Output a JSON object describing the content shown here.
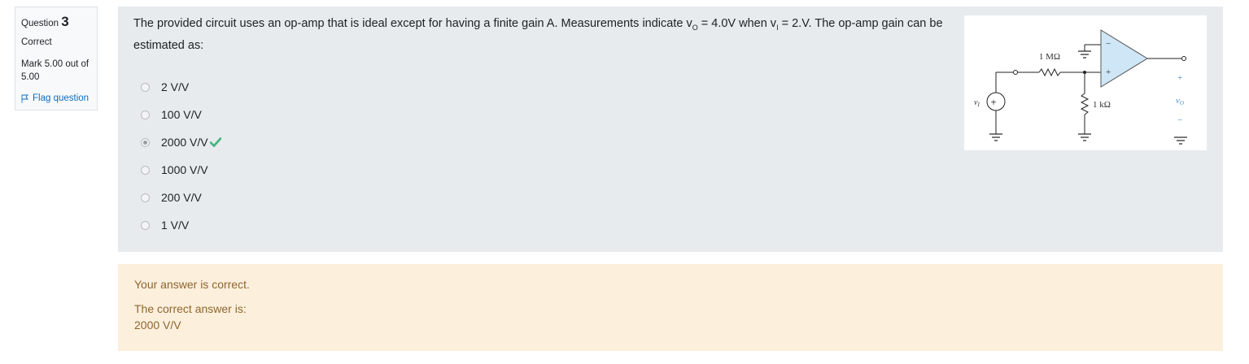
{
  "info": {
    "question_word": "Question",
    "question_number": "3",
    "state": "Correct",
    "grade": "Mark 5.00 out of 5.00",
    "flag_label": "Flag question"
  },
  "question": {
    "text_parts": [
      "The provided circuit uses an op-amp that is ideal except for having a finite gain A.  Measurements indicate v",
      "O",
      " = 4.0V when v",
      "I",
      " = 2.V.  The op-amp gain can be estimated as:"
    ],
    "answers": [
      {
        "label": "2 V/V",
        "checked": false,
        "correct_mark": false
      },
      {
        "label": "100 V/V",
        "checked": false,
        "correct_mark": false
      },
      {
        "label": "2000 V/V",
        "checked": true,
        "correct_mark": true
      },
      {
        "label": "1000 V/V",
        "checked": false,
        "correct_mark": false
      },
      {
        "label": "200 V/V",
        "checked": false,
        "correct_mark": false
      },
      {
        "label": "1 V/V",
        "checked": false,
        "correct_mark": false
      }
    ]
  },
  "figure": {
    "resistor_top": "1 MΩ",
    "resistor_bottom": "1 kΩ",
    "source_label": "v",
    "source_sub": "I",
    "output_label": "v",
    "output_sub": "O",
    "plus_sign": "+",
    "minus_sign": "−",
    "opamp_color": "#cfe6f6"
  },
  "feedback": {
    "status": "Your answer is correct.",
    "correct_intro": "The correct answer is:",
    "correct_value": "2000 V/V"
  },
  "colors": {
    "check": "#3fb37a",
    "link": "#0f6cbf",
    "feedback_text": "#8e662e"
  }
}
